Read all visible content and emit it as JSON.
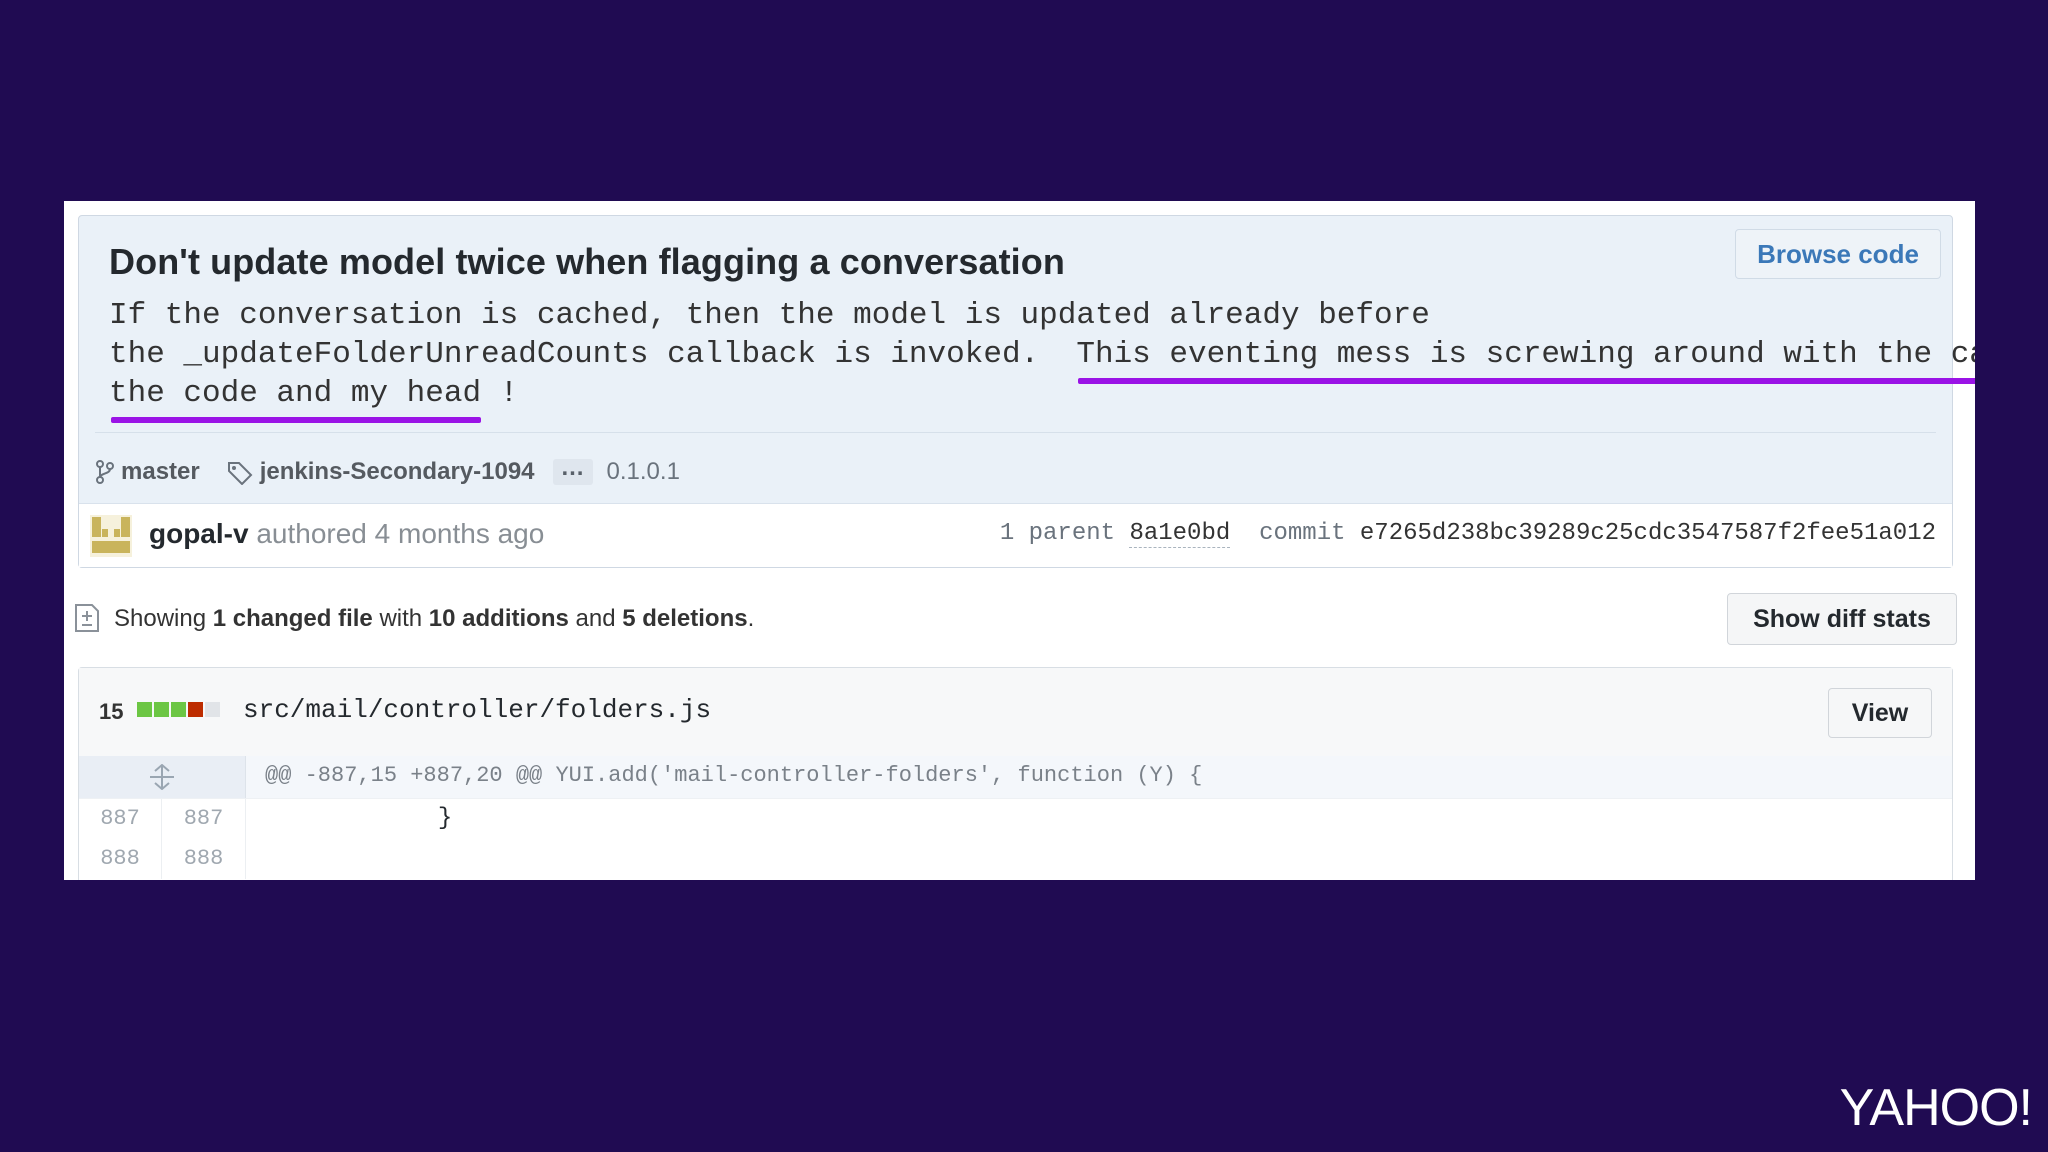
{
  "commit": {
    "title": "Don't update model twice when flagging a conversation",
    "browse_label": "Browse code",
    "desc_line1": "If the conversation is cached, then the model is updated already before",
    "desc_line2_plain": "the _updateFolderUnreadCounts callback is invoked.  ",
    "desc_line2_highlight": "This eventing mess is screwing around with the cache",
    "desc_line2_tail": ",",
    "desc_line3_highlight": "the code and my head",
    "desc_line3_tail": " !",
    "branch": "master",
    "tag": "jenkins-Secondary-1094",
    "ellipsis": "…",
    "version": "0.1.0.1",
    "author": "gopal-v",
    "authored_text": "authored 4 months ago",
    "parent_count_label": "1 parent",
    "parent_sha": "8a1e0bd",
    "commit_label": "commit",
    "commit_sha": "e7265d238bc39289c25cdc3547587f2fee51a012"
  },
  "toc": {
    "prefix": "Showing ",
    "changed": "1 changed file",
    "with": " with ",
    "additions": "10 additions",
    "and": " and ",
    "deletions": "5 deletions",
    "suffix": ".",
    "diff_stats_label": "Show diff stats"
  },
  "file": {
    "diff_count": "15",
    "blocks": [
      "#6cc644",
      "#6cc644",
      "#6cc644",
      "#bd2c00",
      "#e1e4e8"
    ],
    "path": "src/mail/controller/folders.js",
    "view_label": "View",
    "hunk_header": "@@ -887,15 +887,20 @@ YUI.add('mail-controller-folders', function (Y) {",
    "lines": [
      {
        "old": "887",
        "new": "887",
        "text": "            }"
      },
      {
        "old": "888",
        "new": "888",
        "text": ""
      }
    ]
  },
  "brand": "YAHOO!",
  "colors": {
    "background": "#200b52",
    "highlight": "#9a13e6",
    "link": "#3b78b8"
  }
}
